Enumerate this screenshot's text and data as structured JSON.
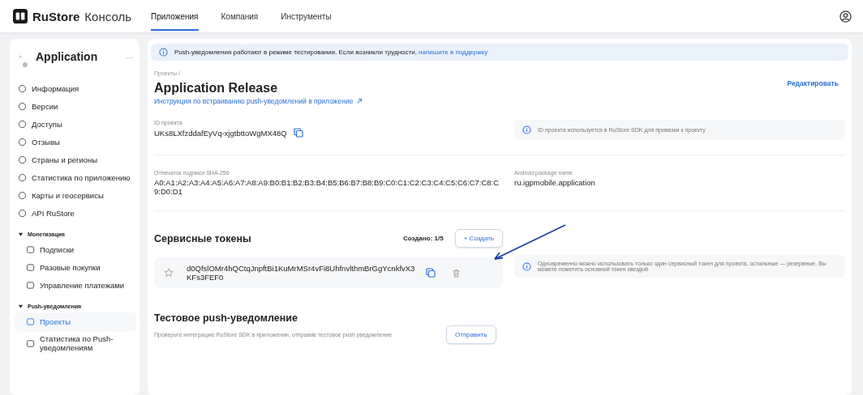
{
  "header": {
    "logo_text": "RuStore",
    "logo_suffix": "Консоль",
    "nav": [
      {
        "label": "Приложения",
        "selected": true
      },
      {
        "label": "Компания",
        "selected": false
      },
      {
        "label": "Инструменты",
        "selected": false
      }
    ]
  },
  "sidebar": {
    "app_name": "Application",
    "more": "···",
    "items": [
      {
        "kind": "item",
        "label": "Информация",
        "selected": false
      },
      {
        "kind": "item",
        "label": "Версии",
        "selected": false
      },
      {
        "kind": "item",
        "label": "Доступы",
        "selected": false
      },
      {
        "kind": "item",
        "label": "Отзывы",
        "selected": false
      },
      {
        "kind": "item",
        "label": "Страны и регионы",
        "selected": false
      },
      {
        "kind": "item",
        "label": "Статистика по приложению",
        "selected": false
      },
      {
        "kind": "item",
        "label": "Карты и геосервисы",
        "selected": false
      },
      {
        "kind": "item",
        "label": "API RuStore",
        "selected": false
      },
      {
        "kind": "group",
        "label": "Монетизация",
        "expanded": true,
        "children": [
          {
            "label": "Подписки",
            "selected": false
          },
          {
            "label": "Разовые покупки",
            "selected": false
          },
          {
            "label": "Управление платежами",
            "selected": false
          }
        ]
      },
      {
        "kind": "group",
        "label": "Push-уведомления",
        "expanded": true,
        "children": [
          {
            "label": "Проекты",
            "selected": true
          },
          {
            "label": "Статистика по Push-уведомлениям",
            "selected": false
          }
        ]
      }
    ]
  },
  "banner": {
    "text": "Push-уведомления работают в режиме тестирования. Если возникли трудности, ",
    "link": "напишите в поддержку"
  },
  "project": {
    "breadcrumb": "Проекты /",
    "title": "Application Release",
    "guide_link": "Инструкция по встраиванию push-уведомлений в приложение",
    "edit": "Редактировать",
    "id_label": "ID проекта",
    "id_value": "UKs8LXfzddafEyVq-xjgtbttoWgMX48Q",
    "id_hint": "ID проекта используется в RuStore SDK для привязки к проекту",
    "sha_label": "Отпечаток подписи SHA-256",
    "sha_value": "A0:A1:A2:A3:A4:A5:A6:A7:A8:A9:B0:B1:B2:B3:B4:B5:B6:B7:B8:B9:C0:C1:C2:C3:C4:C5:C6:C7:C8:C9:D0:D1",
    "package_label": "Android package name",
    "package_value": "ru.igpmobile.application"
  },
  "tokens": {
    "title": "Сервисные токены",
    "count": "Создано: 1/5",
    "create_button": "+ Создать",
    "items": [
      {
        "value": "d0QfslOMr4hQCtqJnpftBi1KuMrMSr4vFi8UhfnvlthmBrGgYcnkfvX3KFs3FEF0",
        "starred": false
      }
    ],
    "hint": "Одновременно можно использовать только один сервисный токен для проекта, остальные — резервные. Вы можете пометить основной токен звездой"
  },
  "test_push": {
    "title": "Тестовое push-уведомление",
    "description": "Проверьте интеграцию RuStore SDK в приложении, отправив тестовое push уведомление",
    "button": "Отправить"
  }
}
